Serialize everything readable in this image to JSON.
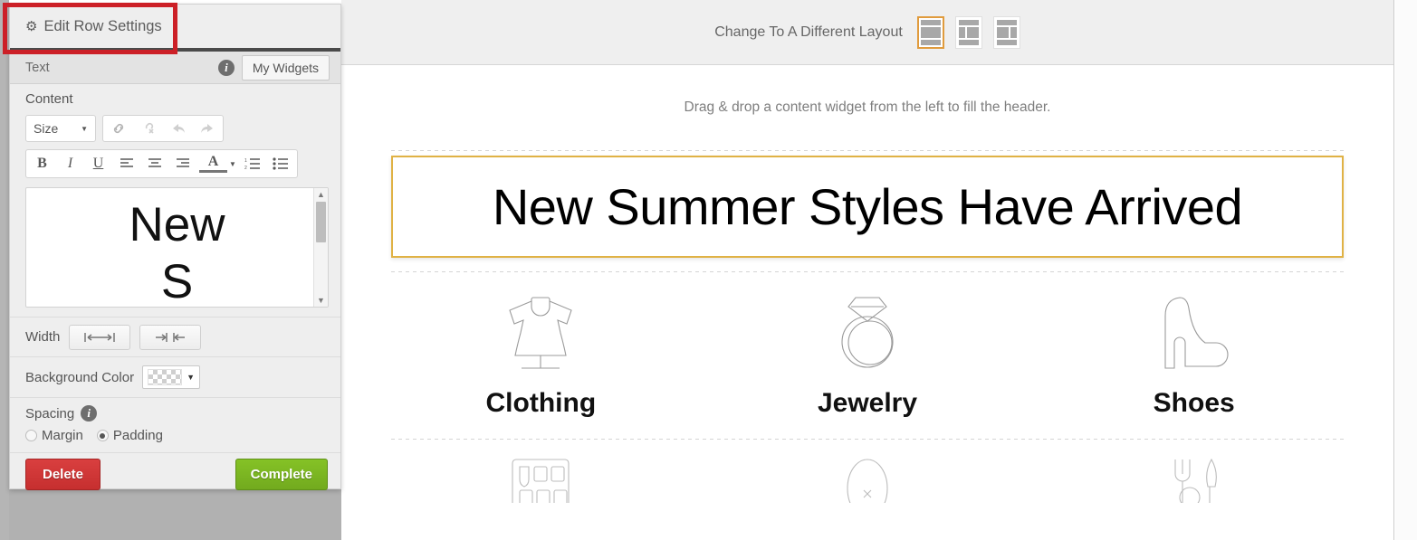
{
  "editor_panel": {
    "header_title": "Edit Row Settings",
    "header_icon": "gear-icon",
    "tab_label": "Text",
    "info_icon": "info-icon",
    "my_widgets_label": "My Widgets",
    "content_label": "Content",
    "toolbar": {
      "size_label": "Size",
      "size_caret": "▼",
      "link_icon": "link-icon",
      "unlink_icon": "unlink-icon",
      "undo_icon": "undo-arrow-icon",
      "redo_icon": "redo-arrow-icon",
      "bold_label": "B",
      "italic_label": "I",
      "underline_label": "U",
      "align_left_icon": "align-left-icon",
      "align_center_icon": "align-center-icon",
      "align_right_icon": "align-right-icon",
      "text_color_label": "A",
      "text_color_caret": "▼",
      "numbered_list_icon": "numbered-list-icon",
      "bullet_list_icon": "bullet-list-icon"
    },
    "editor_value": "New\nS",
    "scroll_up": "▲",
    "scroll_down": "▼",
    "width_label": "Width",
    "width_full_icon": "width-full-icon",
    "width_shrink_icon": "width-shrink-icon",
    "background_color_label": "Background Color",
    "background_color_value": "transparent",
    "background_caret": "▼",
    "spacing_label": "Spacing",
    "spacing_info_icon": "info-icon",
    "margin_label": "Margin",
    "padding_label": "Padding",
    "spacing_selected": "Padding",
    "delete_label": "Delete",
    "complete_label": "Complete",
    "accent_colors": {
      "delete_red": "#c62f2f",
      "complete_green": "#72aa1e",
      "header_underline": "#4a4a4a"
    }
  },
  "highlight": {
    "color": "#cc2027",
    "target": "Edit Row Settings"
  },
  "topbar": {
    "layout_label": "Change To A Different Layout",
    "layouts": [
      {
        "name": "layout-single-column",
        "selected": true
      },
      {
        "name": "layout-two-column-left",
        "selected": false
      },
      {
        "name": "layout-two-column-right",
        "selected": false
      }
    ],
    "selected_border_color": "#e09b3d"
  },
  "canvas": {
    "drag_hint": "Drag & drop a content widget from the left to fill the header.",
    "hero": {
      "text": "New Summer Styles Have Arrived",
      "border_color": "#e0b245",
      "selected": true
    },
    "categories": [
      {
        "label": "Clothing",
        "icon": "dress-form-icon"
      },
      {
        "label": "Jewelry",
        "icon": "ring-icon"
      },
      {
        "label": "Shoes",
        "icon": "high-heel-icon"
      }
    ],
    "categories_row2": [
      {
        "label": "",
        "icon": "makeup-palette-icon"
      },
      {
        "label": "",
        "icon": "perfume-bottle-icon"
      },
      {
        "label": "",
        "icon": "fork-and-knife-icon"
      }
    ]
  }
}
